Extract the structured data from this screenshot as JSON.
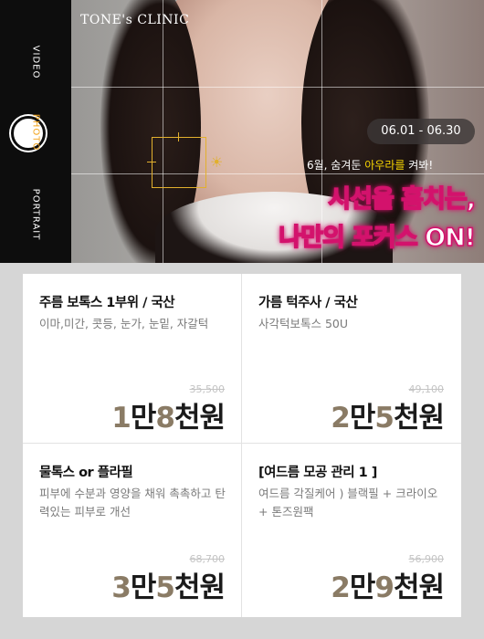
{
  "hero": {
    "logo": "TONE's CLINIC",
    "date_range": "06.01 - 06.30",
    "subtitle_prefix": "6월, 숨겨둔 ",
    "subtitle_accent": "아우라를",
    "subtitle_suffix": " 켜봐!",
    "headline_line1": "시선을 훔치는,",
    "headline_line2": "나만의 포커스 ON!"
  },
  "camera": {
    "modes": [
      "VIDEO",
      "PHOTO",
      "PORTRAIT"
    ],
    "active_mode": "PHOTO",
    "active_color": "#f2a31b"
  },
  "products": [
    {
      "title": "주름 보톡스 1부위 / 국산",
      "description": "이마,미간, 콧등, 눈가, 눈밑, 자갈턱",
      "old_price": "35,500",
      "price_parts": [
        "1",
        "만",
        "8",
        "천원"
      ]
    },
    {
      "title": "가름 턱주사 / 국산",
      "description": "사각턱보톡스 50U",
      "old_price": "49,100",
      "price_parts": [
        "2",
        "만",
        "5",
        "천원"
      ]
    },
    {
      "title": "물톡스 or 플라필",
      "description": "피부에 수분과 영양을 채워 촉촉하고 탄력있는 피부로 개선",
      "old_price": "68,700",
      "price_parts": [
        "3",
        "만",
        "5",
        "천원"
      ]
    },
    {
      "title": "[여드름 모공 관리 1 ]",
      "description": "여드름 각질케어 ) 블랙필 + 크라이오 + 톤즈원팩",
      "old_price": "56,900",
      "price_parts": [
        "2",
        "만",
        "9",
        "천원"
      ]
    }
  ],
  "colors": {
    "price_accent": "#8a7b65",
    "headline_glow": "#d3126c",
    "subtitle_accent": "#f6d400",
    "focus": "#e2b02e"
  },
  "icons": {
    "sun": "sun-icon",
    "shutter": "shutter-button"
  }
}
